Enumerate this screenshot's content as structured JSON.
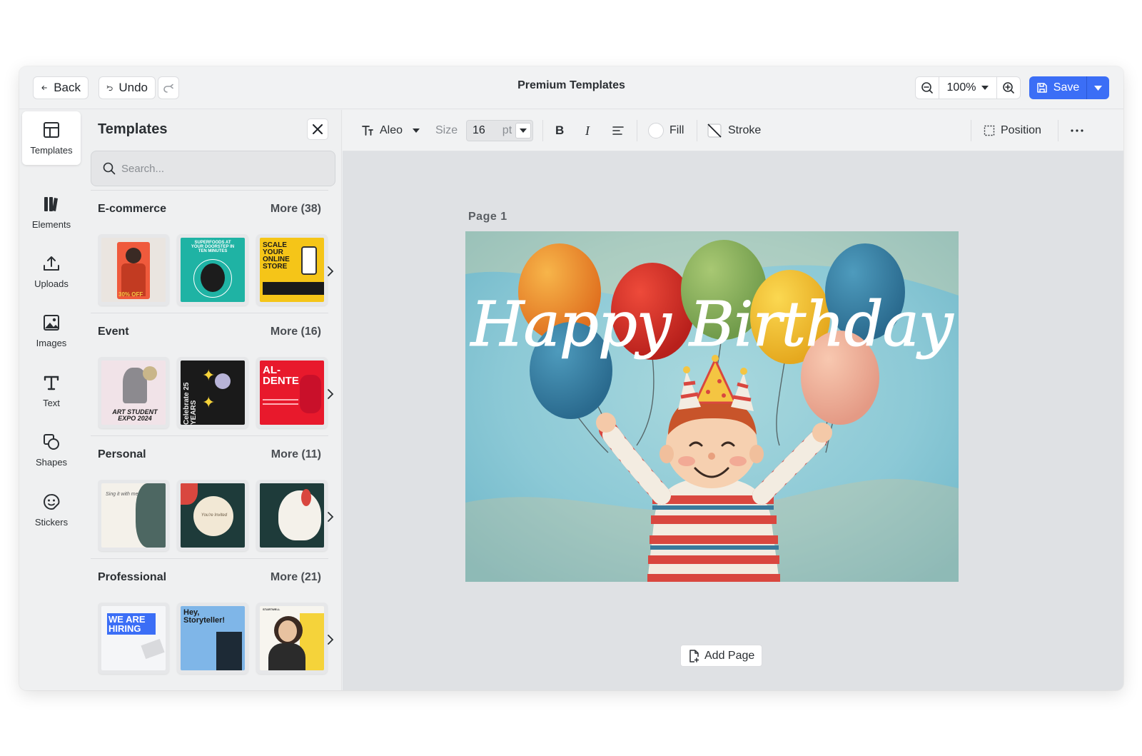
{
  "topbar": {
    "back_label": "Back",
    "undo_label": "Undo",
    "title": "Premium Templates",
    "zoom_value": "100%",
    "save_label": "Save"
  },
  "rail": {
    "items": [
      {
        "label": "Templates",
        "icon": "layout-icon",
        "active": true
      },
      {
        "label": "Elements",
        "icon": "elements-icon"
      },
      {
        "label": "Uploads",
        "icon": "upload-icon"
      },
      {
        "label": "Images",
        "icon": "image-icon"
      },
      {
        "label": "Text",
        "icon": "text-icon"
      },
      {
        "label": "Shapes",
        "icon": "shapes-icon"
      },
      {
        "label": "Stickers",
        "icon": "sticker-icon"
      }
    ]
  },
  "panel": {
    "title": "Templates",
    "search_placeholder": "Search...",
    "categories": [
      {
        "name": "E-commerce",
        "more": "More (38)",
        "thumbs": [
          {
            "text": "30% OFF",
            "bg": "#e9e4df"
          },
          {
            "text": "SUPERFOODS AT YOUR DOORSTEP IN TEN MINUTES",
            "bg": "#1fb3a4"
          },
          {
            "text": "SCALE YOUR ONLINE STORE",
            "bg": "#f5c518"
          }
        ]
      },
      {
        "name": "Event",
        "more": "More (16)",
        "thumbs": [
          {
            "text": "ART STUDENT EXPO 2024",
            "bg": "#f1e3e8"
          },
          {
            "text": "Celebrate 25 YEARS",
            "bg": "#1a1a1a"
          },
          {
            "text": "AL-DENTE",
            "bg": "#e8192c"
          }
        ]
      },
      {
        "name": "Personal",
        "more": "More (11)",
        "thumbs": [
          {
            "text": "Sing it with me",
            "bg": "#f4f1ea"
          },
          {
            "text": "You're Invited",
            "bg": "#f2e8d5"
          },
          {
            "text": "",
            "bg": "#1e3b3a"
          }
        ]
      },
      {
        "name": "Professional",
        "more": "More (21)",
        "thumbs": [
          {
            "text": "WE ARE HIRING",
            "bg": "#f5f6f8"
          },
          {
            "text": "Hey, Storyteller!",
            "bg": "#7fb6e8"
          },
          {
            "text": "STARTWELL",
            "bg": "#f7f5ef"
          }
        ]
      }
    ]
  },
  "format": {
    "font_name": "Aleo",
    "size_label": "Size",
    "size_value": "16",
    "size_unit": "pt",
    "bold_label": "B",
    "italic_label": "I",
    "fill_label": "Fill",
    "stroke_label": "Stroke",
    "position_label": "Position"
  },
  "canvas": {
    "page_label": "Page  1",
    "artboard_text": "Happy Birthday",
    "add_page_label": "Add Page"
  },
  "colors": {
    "accent": "#3b6ef6",
    "app_bg": "#eff0f1",
    "canvas_bg": "#dfe1e4",
    "artboard_sky": "#8cc9d6"
  }
}
